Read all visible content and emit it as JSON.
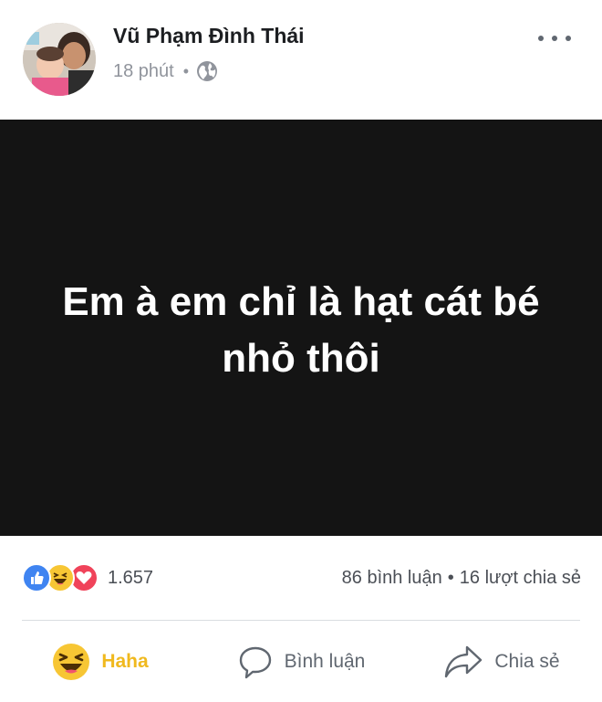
{
  "post": {
    "author": "Vũ Phạm Đình Thái",
    "time": "18 phút",
    "privacy_icon": "globe-icon",
    "text": "Em à em chỉ là hạt cát bé nhỏ thôi",
    "background_color": "#141414"
  },
  "reactions": {
    "types": [
      "like",
      "haha",
      "love"
    ],
    "count": "1.657",
    "comments": "86 bình luận",
    "separator": "•",
    "shares": "16 lượt chia sẻ"
  },
  "actions": [
    {
      "label": "Haha",
      "icon": "haha-emoji-icon",
      "active": true,
      "color": "#f0b91e"
    },
    {
      "label": "Bình luận",
      "icon": "comment-icon",
      "active": false
    },
    {
      "label": "Chia sẻ",
      "icon": "share-icon",
      "active": false
    }
  ]
}
